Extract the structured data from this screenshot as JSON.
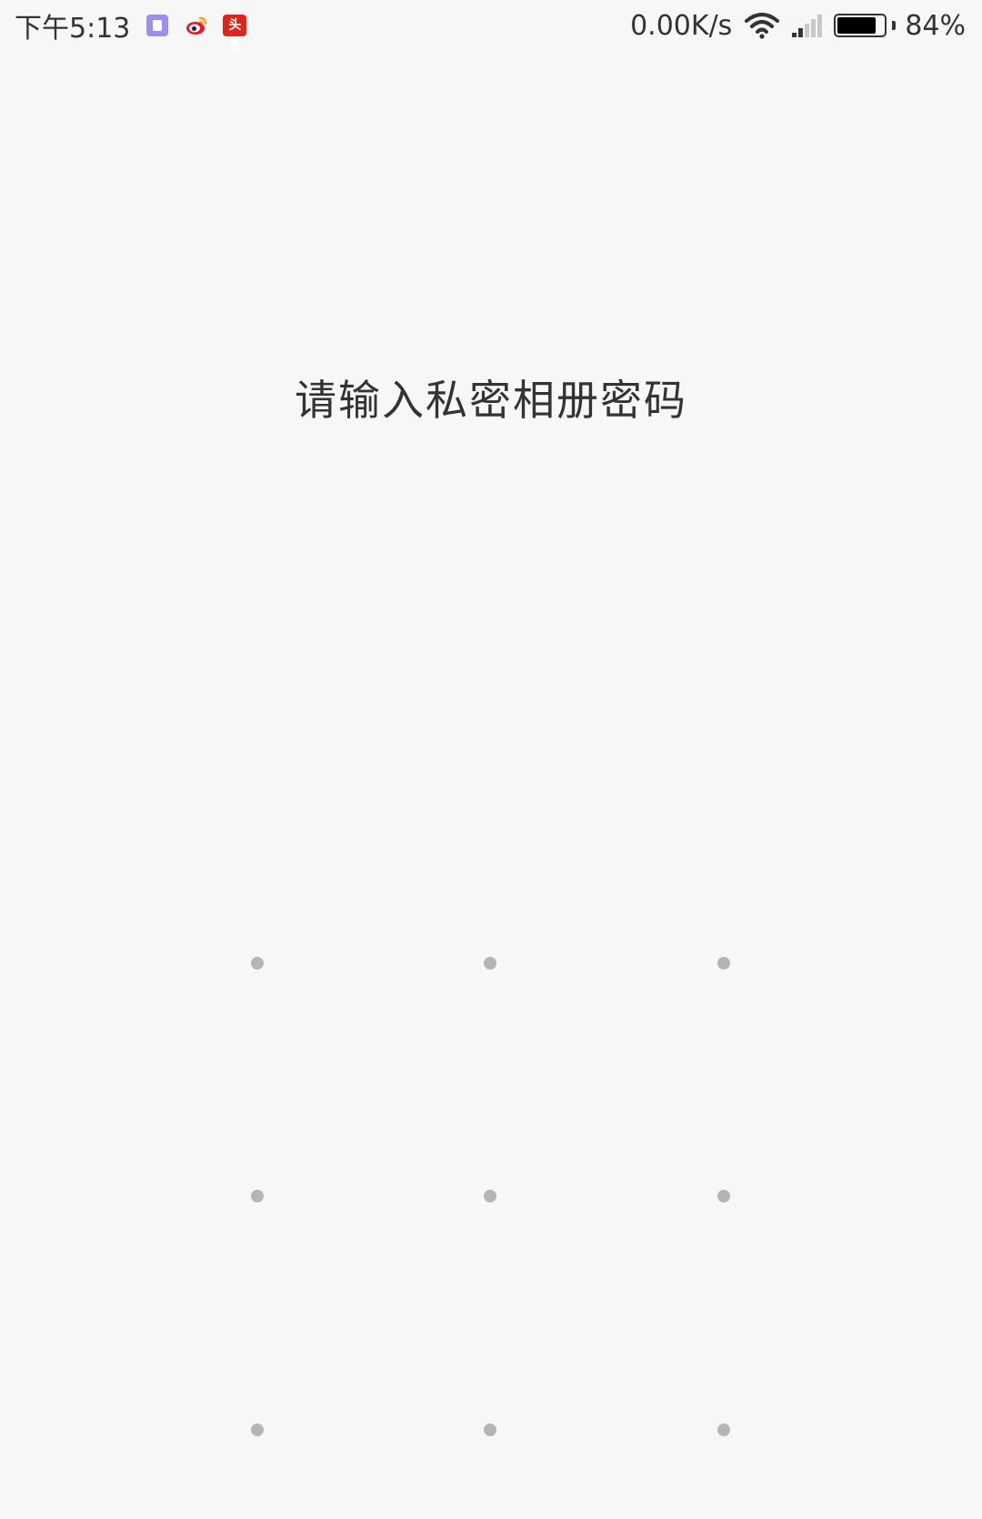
{
  "status_bar": {
    "time": "下午5:13",
    "notification_icons": [
      "app-purple-icon",
      "weibo-icon",
      "toutiao-icon"
    ],
    "toutiao_label": "头条",
    "net_speed": "0.00K/s",
    "wifi_icon": "wifi-icon",
    "signal_icon": "signal-icon",
    "battery_level": 0.84,
    "battery_percent": "84%"
  },
  "lock_screen": {
    "prompt": "请输入私密相册密码",
    "pattern": {
      "rows": 3,
      "cols": 3,
      "dot_color": "#b5b5b5"
    }
  },
  "colors": {
    "background": "#f7f7f7",
    "text": "#333333",
    "toutiao_red": "#e2231a",
    "app_purple": "#9d8ff0"
  }
}
